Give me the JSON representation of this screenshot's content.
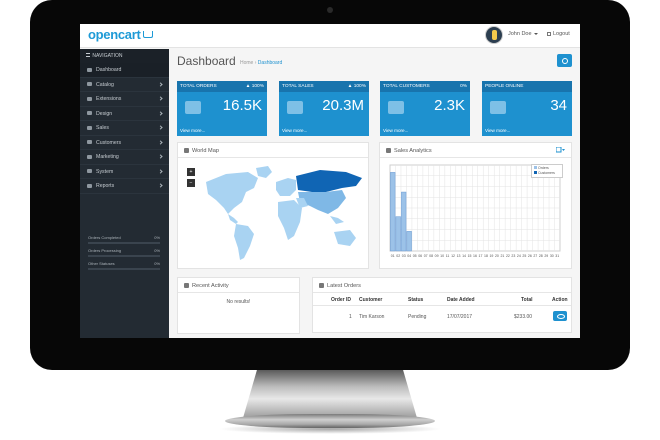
{
  "header": {
    "logo_text": "opencart",
    "user_name": "John Doe",
    "logout_label": "Logout"
  },
  "sidebar": {
    "heading": "NAVIGATION",
    "items": [
      {
        "label": "Dashboard",
        "icon": "dashboard-icon",
        "has_children": false
      },
      {
        "label": "Catalog",
        "icon": "tag-icon",
        "has_children": true
      },
      {
        "label": "Extensions",
        "icon": "puzzle-icon",
        "has_children": true
      },
      {
        "label": "Design",
        "icon": "monitor-icon",
        "has_children": true
      },
      {
        "label": "Sales",
        "icon": "cart-icon",
        "has_children": true
      },
      {
        "label": "Customers",
        "icon": "user-icon",
        "has_children": true
      },
      {
        "label": "Marketing",
        "icon": "share-icon",
        "has_children": true
      },
      {
        "label": "System",
        "icon": "gear-icon",
        "has_children": true
      },
      {
        "label": "Reports",
        "icon": "bar-chart-icon",
        "has_children": true
      }
    ],
    "progress": [
      {
        "label": "Orders Completed",
        "value": "0%",
        "fill": 0
      },
      {
        "label": "Orders Processing",
        "value": "0%",
        "fill": 0
      },
      {
        "label": "Other Statuses",
        "value": "0%",
        "fill": 0
      }
    ]
  },
  "page": {
    "title": "Dashboard",
    "breadcrumb_home": "Home",
    "breadcrumb_sep": "›",
    "breadcrumb_current": "Dashboard"
  },
  "tiles": [
    {
      "title": "TOTAL ORDERS",
      "pct": "▲ 100%",
      "value": "16.5K",
      "footer": "View more...",
      "icon": "cart-icon"
    },
    {
      "title": "TOTAL SALES",
      "pct": "▲ 100%",
      "value": "20.3M",
      "footer": "View more...",
      "icon": "credit-card-icon"
    },
    {
      "title": "TOTAL CUSTOMERS",
      "pct": "0%",
      "value": "2.3K",
      "footer": "View more...",
      "icon": "user-icon"
    },
    {
      "title": "PEOPLE ONLINE",
      "pct": "",
      "value": "34",
      "footer": "View more...",
      "icon": "users-icon"
    }
  ],
  "world_map": {
    "title": "World Map",
    "zoom_in": "+",
    "zoom_out": "−"
  },
  "sales_analytics": {
    "title": "Sales Analytics"
  },
  "chart_data": {
    "type": "bar",
    "title": "Sales Analytics",
    "categories": [
      "01",
      "02",
      "03",
      "04",
      "05",
      "06",
      "07",
      "08",
      "09",
      "10",
      "11",
      "12",
      "13",
      "14",
      "15",
      "16",
      "17",
      "18",
      "19",
      "20",
      "21",
      "22",
      "23",
      "24",
      "25",
      "26",
      "27",
      "28",
      "29",
      "30",
      "31"
    ],
    "series": [
      {
        "name": "Orders",
        "color": "#9cc2e8",
        "values": [
          32,
          14,
          24,
          8,
          0,
          0,
          0,
          0,
          0,
          0,
          0,
          0,
          0,
          0,
          0,
          0,
          0,
          0,
          0,
          0,
          0,
          0,
          0,
          0,
          0,
          0,
          0,
          0,
          0,
          0,
          0
        ]
      },
      {
        "name": "Customers",
        "color": "#1065b4",
        "values": [
          0,
          0,
          0,
          0,
          0,
          0,
          0,
          0,
          0,
          0,
          0,
          0,
          0,
          0,
          0,
          0,
          0,
          0,
          0,
          0,
          0,
          0,
          0,
          0,
          0,
          0,
          0,
          0,
          0,
          0,
          0
        ]
      }
    ],
    "ylim": [
      0,
      35
    ],
    "grid": true,
    "legend": "top-right"
  },
  "recent_activity": {
    "title": "Recent Activity",
    "empty_text": "No results!"
  },
  "latest_orders": {
    "title": "Latest Orders",
    "columns": [
      "Order ID",
      "Customer",
      "Status",
      "Date Added",
      "Total",
      "Action"
    ],
    "rows": [
      {
        "order_id": "1",
        "customer": "Tim Karson",
        "status": "Pending",
        "date_added": "17/07/2017",
        "total": "$233.00"
      }
    ]
  },
  "colors": {
    "accent": "#1e91cf",
    "sidebar": "#232b33",
    "map_highlight": "#1065b4",
    "map_land": "#a9d3f2"
  }
}
